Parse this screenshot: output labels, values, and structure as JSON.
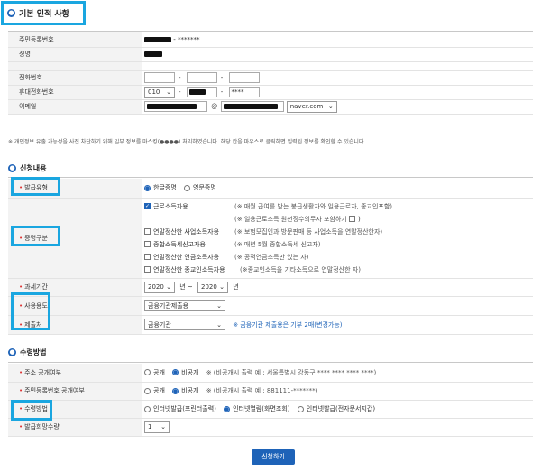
{
  "section1": {
    "title": "기본 인적 사항",
    "rows": {
      "resident_label": "주민등록번호",
      "resident_tail": "- *******",
      "name_label": "성명",
      "phone_label": "전화번호",
      "mobile_label": "휴대전화번호",
      "mobile_prefix": "010",
      "mobile_last": "****",
      "email_label": "이메일",
      "email_at": "@",
      "email_domain": "naver.com"
    },
    "notice": "※ 개인정보 유출 가능성을 사전 차단하기 위해 일부 정보를 마스킹(●●●●) 처리하였습니다. 해당 칸을 마우스로 클릭하면 입력된 정보를 확인할 수 있습니다."
  },
  "section2": {
    "title": "신청내용",
    "issue_type_label": "발급유형",
    "issue_options": [
      "한글증명",
      "영문증명"
    ],
    "proof_label": "증명구분",
    "proof_options": [
      {
        "label": "근로소득자용",
        "note": "(※ 매월 급여를 받는 봉급생활자와 일용근로자, 종교인포함)",
        "checked": true
      },
      {
        "label": "",
        "note": "(※ 일용근로소득 원천징수의무자 포함하기",
        "checked": false
      },
      {
        "label": "연말정산한 사업소득자용",
        "note": "(※ 보험모집인과 방문판매 등 사업소득을 연말정산한자)",
        "checked": false
      },
      {
        "label": "종합소득세신고자용",
        "note": "(※ 매년 5월 종합소득세 신고자)",
        "checked": false
      },
      {
        "label": "연말정산한 연금소득자용",
        "note": "(※ 공적연금소득만 있는 자)",
        "checked": false
      },
      {
        "label": "연말정산한 종교인소득자용",
        "note": "(※종교인소득을 기타소득으로 연말정산한 자)",
        "checked": false
      }
    ],
    "period_label": "과세기간",
    "period_from": "2020",
    "period_from_unit": "년 ~",
    "period_to": "2020",
    "period_to_unit": "년",
    "usage_label": "사용용도",
    "usage_value": "금융기관제출용",
    "submit_label": "제출처",
    "submit_value": "금융기관",
    "submit_note": "※ 금융기관 제출용은 기부 2매(변경가능)"
  },
  "section3": {
    "title": "수령방법",
    "addr_label": "주소 공개여부",
    "addr_options": [
      "공개",
      "비공개"
    ],
    "addr_note": "※ (비공개시 출력 예 : 서울특별시 강동구 **** **** **** ****)",
    "resident_label": "주민등록번호 공개여부",
    "resident_options": [
      "공개",
      "비공개"
    ],
    "resident_note": "※ (비공개시 출력 예 : 881111-*******)",
    "receive_label": "수령방법",
    "receive_options": [
      "인터넷발급(프린터출력)",
      "인터넷열람(화면조회)",
      "인터넷발급(전자문서지갑)"
    ],
    "copies_label": "발급희망수량",
    "copies_value": "1"
  },
  "apply_button": "신청하기"
}
